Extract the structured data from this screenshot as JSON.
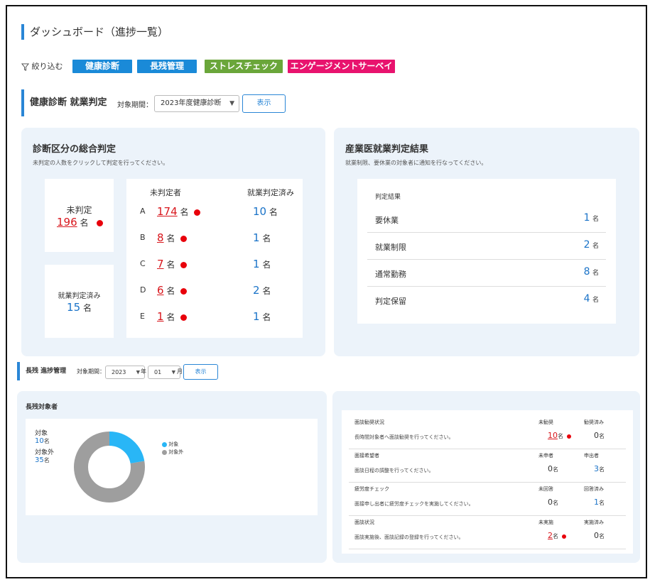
{
  "page": {
    "title": "ダッシュボード（進捗一覧）"
  },
  "filter": {
    "label": "絞り込む",
    "chips": [
      {
        "label": "健康診断",
        "color": "#1a8ad8"
      },
      {
        "label": "長残管理",
        "color": "#1a8ad8"
      },
      {
        "label": "ストレスチェック",
        "color": "#6aa63a"
      },
      {
        "label": "エンゲージメントサーベイ",
        "color": "#e8136e"
      }
    ]
  },
  "health": {
    "section_title": "健康診断 就業判定",
    "period_label": "対象期間：",
    "period_value": "2023年度健康診断",
    "show_button": "表示",
    "overall": {
      "title": "診断区分の総合判定",
      "subtitle": "未判定の人数をクリックして判定を行ってください。",
      "unjudged_label": "未判定",
      "unjudged_count": "196",
      "judged_label": "就業判定済み",
      "judged_count": "15",
      "unit": "名",
      "col_unjudged": "未判定者",
      "col_judged": "就業判定済み",
      "rows": [
        {
          "grade": "A",
          "unjudged": "174",
          "judged": "10"
        },
        {
          "grade": "B",
          "unjudged": "8",
          "judged": "1"
        },
        {
          "grade": "C",
          "unjudged": "7",
          "judged": "1"
        },
        {
          "grade": "D",
          "unjudged": "6",
          "judged": "2"
        },
        {
          "grade": "E",
          "unjudged": "1",
          "judged": "1"
        }
      ]
    },
    "doctor": {
      "title": "産業医就業判定結果",
      "subtitle": "就業制限、要休業の対象者に通知を行なってください。",
      "header": "判定結果",
      "unit": "名",
      "rows": [
        {
          "label": "要休業",
          "count": "1"
        },
        {
          "label": "就業制限",
          "count": "2"
        },
        {
          "label": "通常勤務",
          "count": "8"
        },
        {
          "label": "判定保留",
          "count": "4"
        }
      ]
    }
  },
  "overtime": {
    "section_title": "長残 進捗管理",
    "period_label": "対象期間：",
    "year": "2023",
    "year_suffix": "年",
    "month": "01",
    "month_suffix": "月",
    "show_button": "表示",
    "targets": {
      "title": "長残対象者",
      "target_label": "対象",
      "target_count": "10",
      "other_label": "対象外",
      "other_count": "35",
      "unit": "名",
      "legend_target": "対象",
      "legend_other": "対象外",
      "target_color": "#29b6f6",
      "other_color": "#9e9e9e"
    },
    "interviews": [
      {
        "title": "面談勧奨状況",
        "desc": "長時間対象者へ面談勧奨を行ってください。",
        "col1": "未勧奨",
        "col2": "勧奨済み",
        "v1": "10",
        "v2": "0",
        "alert": true
      },
      {
        "title": "面接希望者",
        "desc": "面談日程の調整を行ってください。",
        "col1": "未申者",
        "col2": "申出者",
        "v1": "0",
        "v2": "3",
        "alert": false
      },
      {
        "title": "疲労度チェック",
        "desc": "面接申し出者に疲労度チェックを実施してください。",
        "col1": "未回答",
        "col2": "回答済み",
        "v1": "0",
        "v2": "1",
        "alert": false
      },
      {
        "title": "面談状況",
        "desc": "面談実施後、面談記録の登録を行ってください。",
        "col1": "未実施",
        "col2": "実施済み",
        "v1": "2",
        "v2": "0",
        "alert": true
      }
    ],
    "unit": "名"
  }
}
